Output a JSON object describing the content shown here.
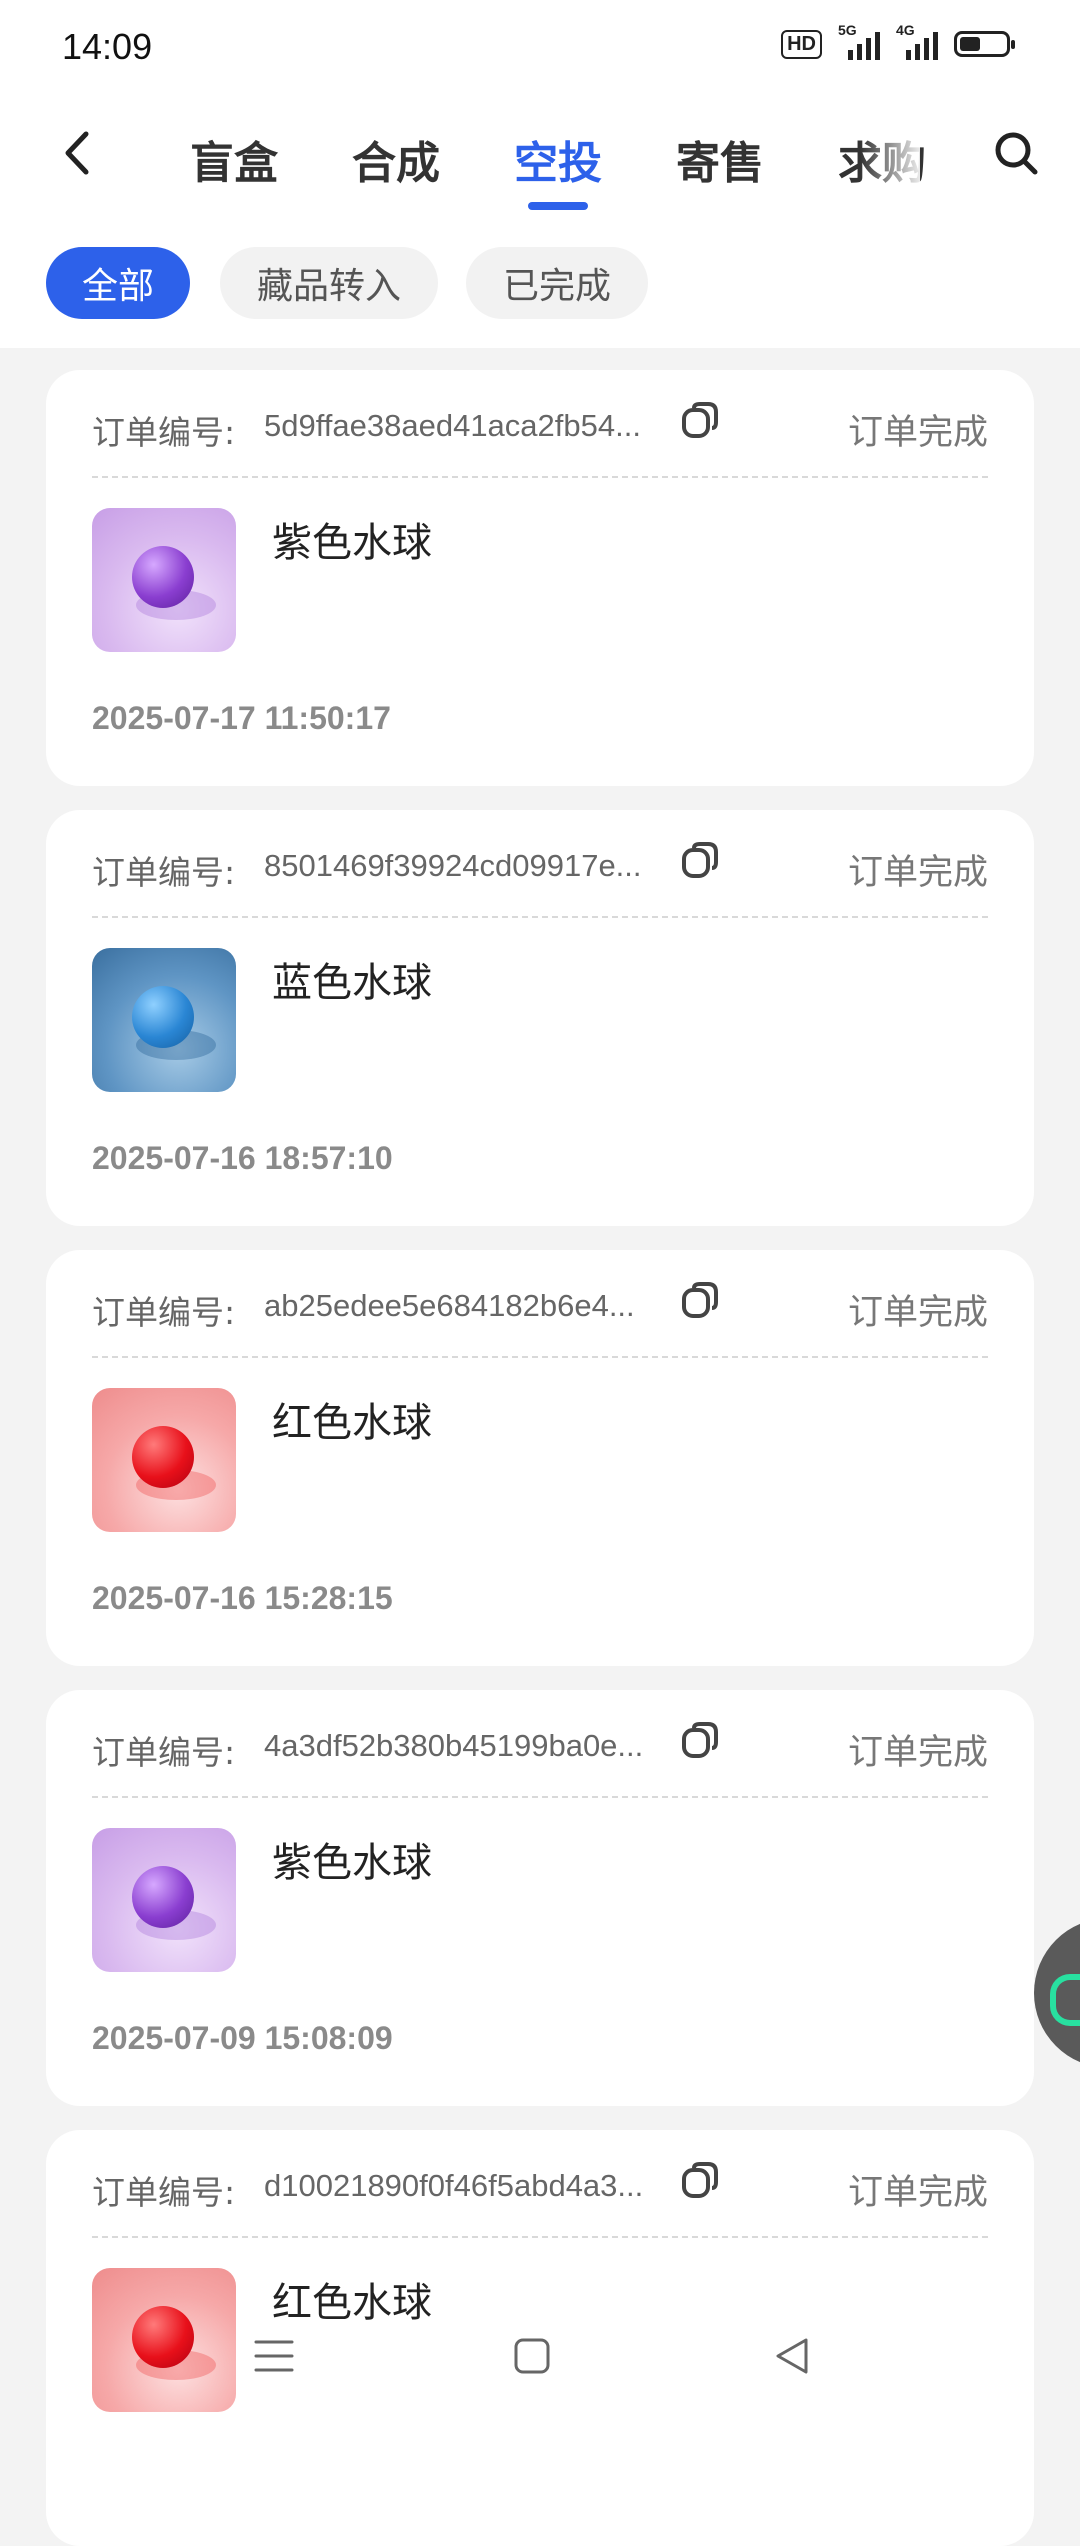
{
  "status_bar": {
    "time": "14:09",
    "hd_label": "HD",
    "sim1_label": "5G",
    "sim2_label": "4G",
    "battery_level": 0.4
  },
  "header": {
    "back_icon": "chevron-left-icon",
    "tabs": [
      {
        "label": "盲盒",
        "active": false
      },
      {
        "label": "合成",
        "active": false
      },
      {
        "label": "空投",
        "active": true
      },
      {
        "label": "寄售",
        "active": false
      },
      {
        "label": "求购",
        "active": false
      }
    ],
    "search_icon": "search-icon"
  },
  "filters": [
    {
      "label": "全部",
      "active": true
    },
    {
      "label": "藏品转入",
      "active": false
    },
    {
      "label": "已完成",
      "active": false
    }
  ],
  "orders": [
    {
      "order_label": "订单编号:",
      "order_id": "5d9ffae38aed41aca2fb54...",
      "status": "订单完成",
      "item_name": "紫色水球",
      "color": "purple",
      "date": "2025-07-17 11:50:17"
    },
    {
      "order_label": "订单编号:",
      "order_id": "8501469f39924cd09917e...",
      "status": "订单完成",
      "item_name": "蓝色水球",
      "color": "blue",
      "date": "2025-07-16 18:57:10"
    },
    {
      "order_label": "订单编号:",
      "order_id": "ab25edee5e684182b6e4...",
      "status": "订单完成",
      "item_name": "红色水球",
      "color": "red",
      "date": "2025-07-16 15:28:15"
    },
    {
      "order_label": "订单编号:",
      "order_id": "4a3df52b380b45199ba0e...",
      "status": "订单完成",
      "item_name": "紫色水球",
      "color": "purple",
      "date": "2025-07-09 15:08:09"
    },
    {
      "order_label": "订单编号:",
      "order_id": "d10021890f0f46f5abd4a3...",
      "status": "订单完成",
      "item_name": "红色水球",
      "color": "red",
      "date": ""
    }
  ],
  "colors": {
    "accent": "#2d61ea",
    "purple_bg": "#d9b9ef",
    "purple_ball": "#8a3ed0",
    "blue_bg": "#5f95c4",
    "blue_ball": "#2a86d4",
    "red_bg": "#f6a8a8",
    "red_ball": "#e8101a"
  },
  "nav_bar": {
    "menu_icon": "menu-icon",
    "home_icon": "square-home-icon",
    "back_icon": "triangle-back-icon"
  }
}
